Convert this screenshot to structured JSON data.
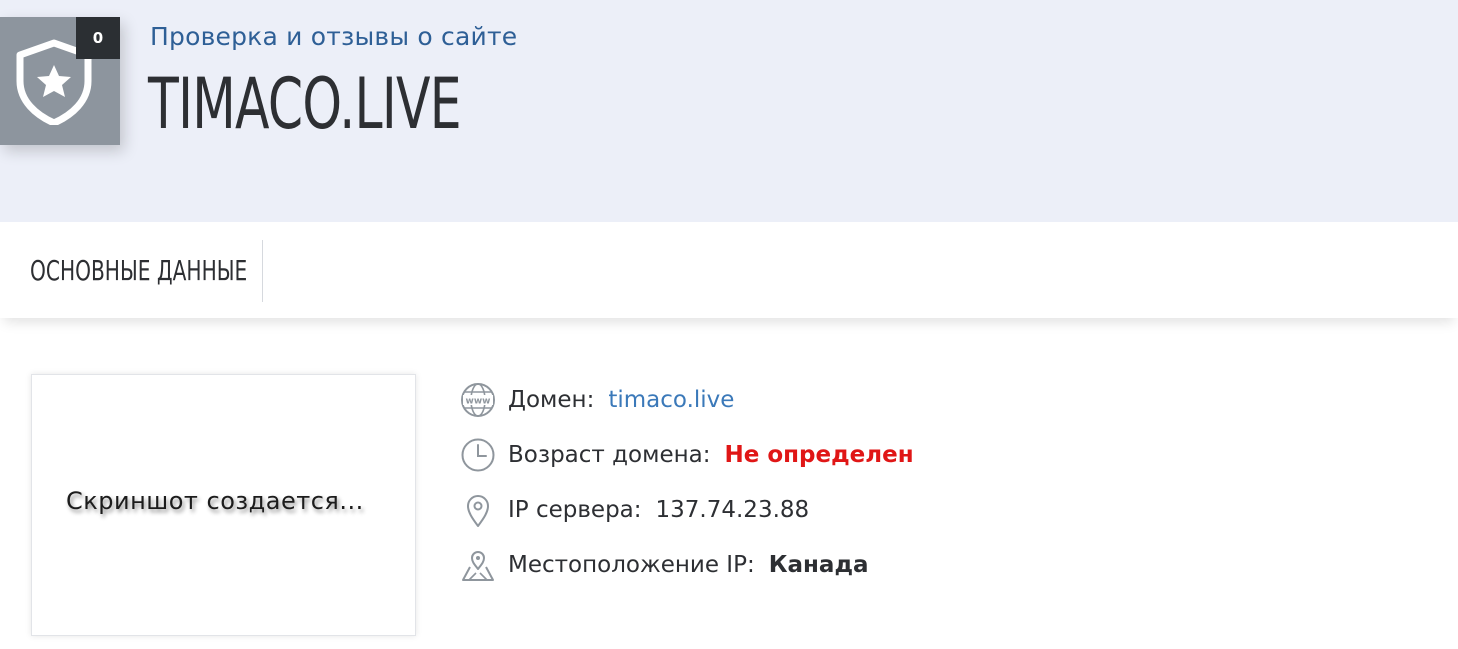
{
  "header": {
    "score": "0",
    "subtitle": "Проверка и отзывы о сайте",
    "site_title": "TIMACO.LIVE"
  },
  "tabs": [
    {
      "label": "ОСНОВНЫЕ ДАННЫЕ"
    }
  ],
  "screenshot": {
    "placeholder_text": "Скриншот создается..."
  },
  "info": {
    "domain": {
      "label": "Домен:",
      "value": "timaco.live",
      "icon": "www-globe-icon"
    },
    "age": {
      "label": "Возраст домена:",
      "value": "Не определен",
      "icon": "clock-icon"
    },
    "ip": {
      "label": "IP сервера:",
      "value": "137.74.23.88",
      "icon": "location-pin-icon"
    },
    "location": {
      "label": "Местоположение IP:",
      "value": "Канада",
      "icon": "map-pin-icon"
    }
  },
  "colors": {
    "header_bg": "#eceff8",
    "shield_bg": "#8d959e",
    "badge_bg": "#2b2f33",
    "subtitle": "#2e5f96",
    "link": "#3b79b9",
    "warning": "#e01616",
    "icon": "#8f969d"
  }
}
